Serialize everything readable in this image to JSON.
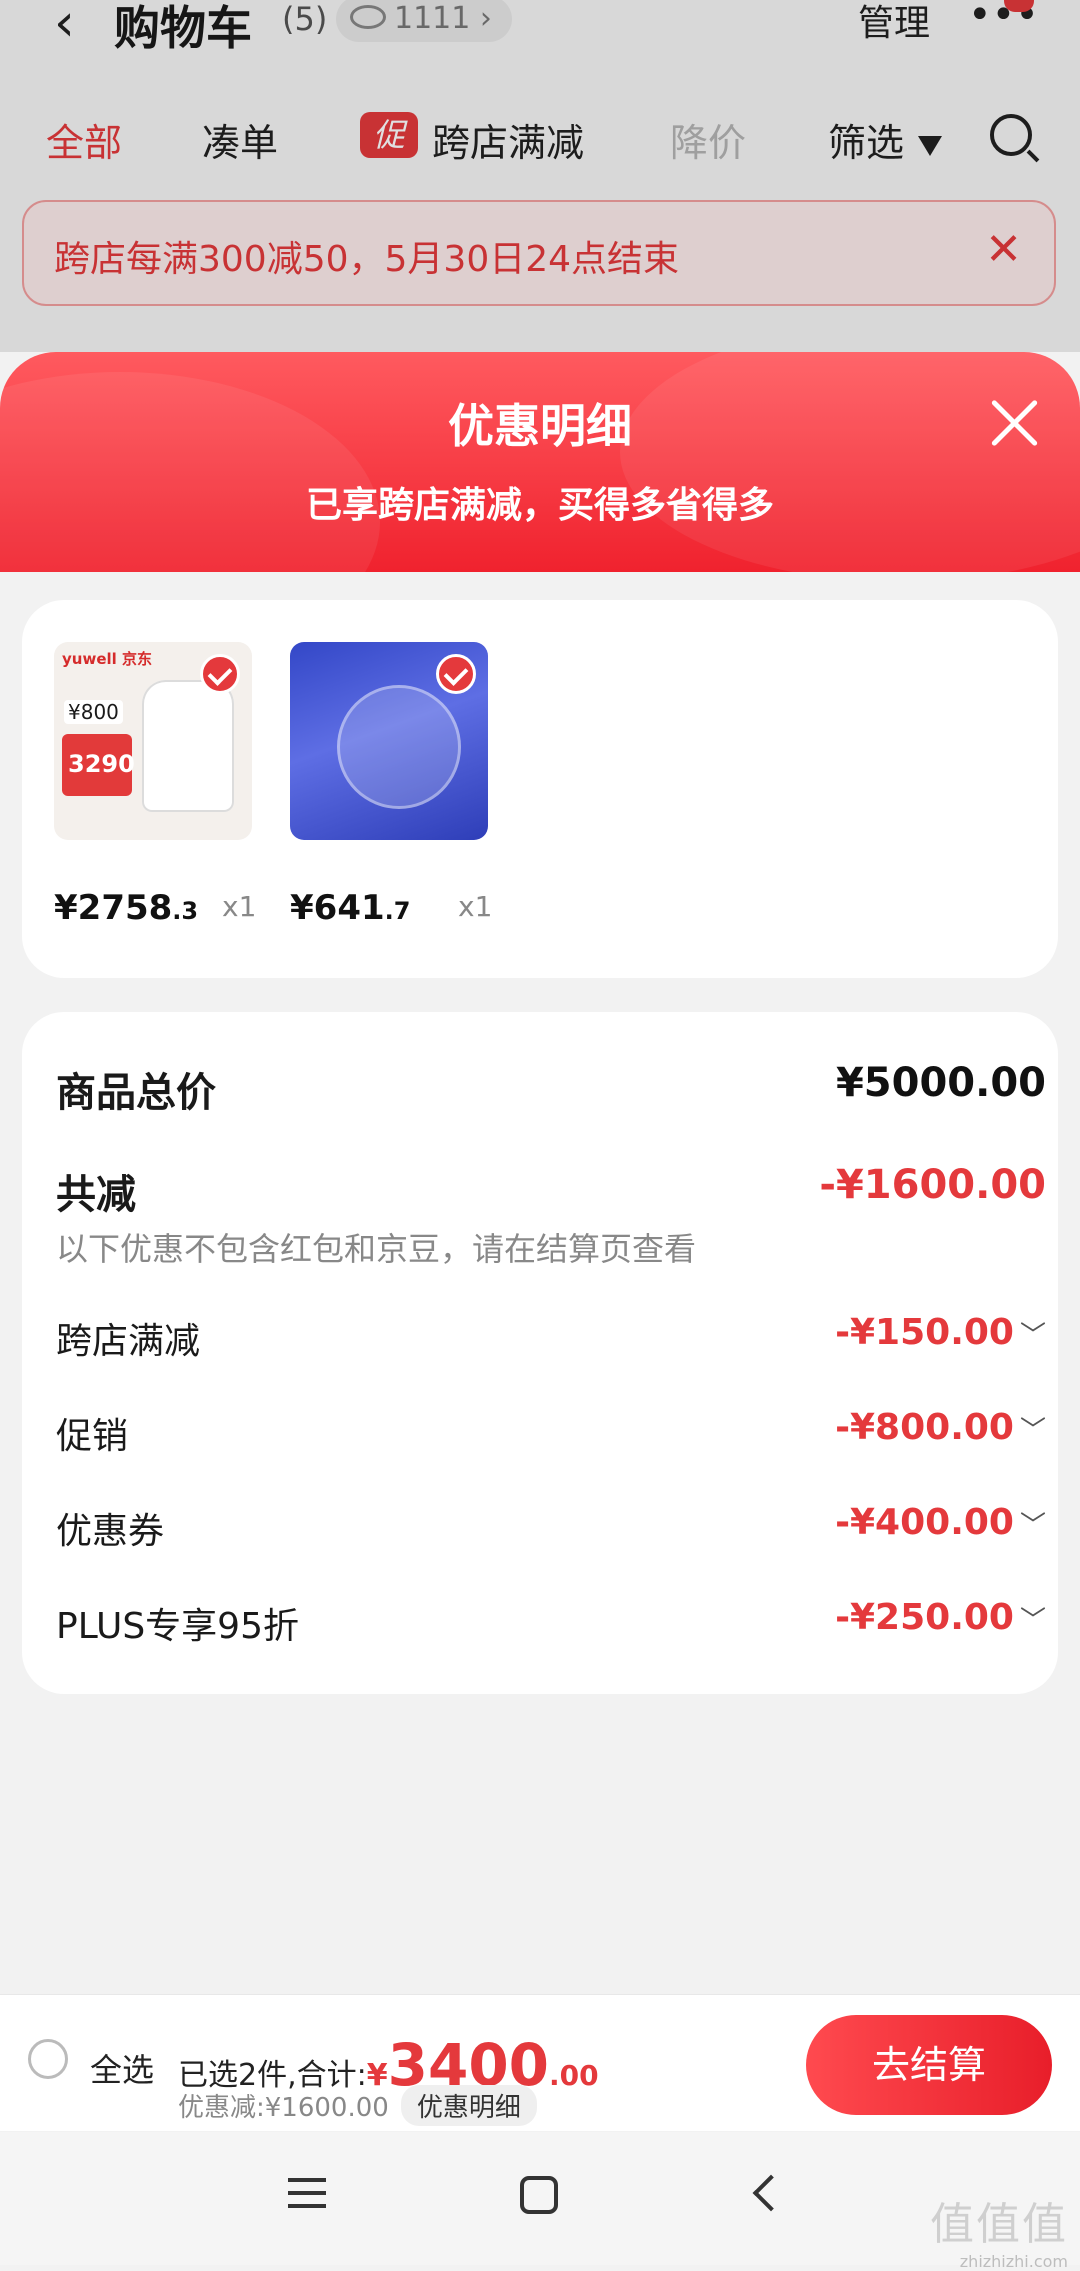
{
  "cart": {
    "back_icon": "chevron-left-icon",
    "title": "购物车",
    "count": "(5)",
    "views": "1111",
    "manage": "管理"
  },
  "filters": {
    "tabs": [
      "全部",
      "凑单",
      "跨店满减",
      "降价",
      "筛选"
    ],
    "promo_tag": "促"
  },
  "notice": {
    "text": "跨店每满300减50，5月30日24点结束"
  },
  "sheet": {
    "title": "优惠明细",
    "subtitle": "已享跨店满减，买得多省得多",
    "products": [
      {
        "name": "yuwell",
        "seller": "京东",
        "thumb_price": "800",
        "thumb_deal": "3290",
        "price_int": "¥2758",
        "price_dec": ".3",
        "qty": "x1"
      },
      {
        "price_int": "¥641",
        "price_dec": ".7",
        "qty": "x1"
      }
    ],
    "summary": {
      "total_label": "商品总价",
      "total_value": "¥5000.00",
      "reduce_label": "共减",
      "reduce_value": "-¥1600.00",
      "note": "以下优惠不包含红包和京豆，请在结算页查看",
      "items": [
        {
          "label": "跨店满减",
          "value": "-¥150.00"
        },
        {
          "label": "促销",
          "value": "-¥800.00"
        },
        {
          "label": "优惠券",
          "value": "-¥400.00"
        },
        {
          "label": "PLUS专享95折",
          "value": "-¥250.00"
        }
      ]
    }
  },
  "bottom": {
    "select_all": "全选",
    "selected_text": "已选2件,合计:",
    "currency": "¥",
    "amount": "3400",
    "amount_dec": ".00",
    "discount": "优惠减:¥1600.00",
    "detail_button": "优惠明细",
    "checkout": "去结算"
  },
  "watermark": {
    "logo": "值值值",
    "url": "zhizhizhi.com"
  },
  "colors": {
    "accent": "#e4393c",
    "sheet_gradient_top": "#ff5a5f",
    "sheet_gradient_bottom": "#f0222e"
  }
}
